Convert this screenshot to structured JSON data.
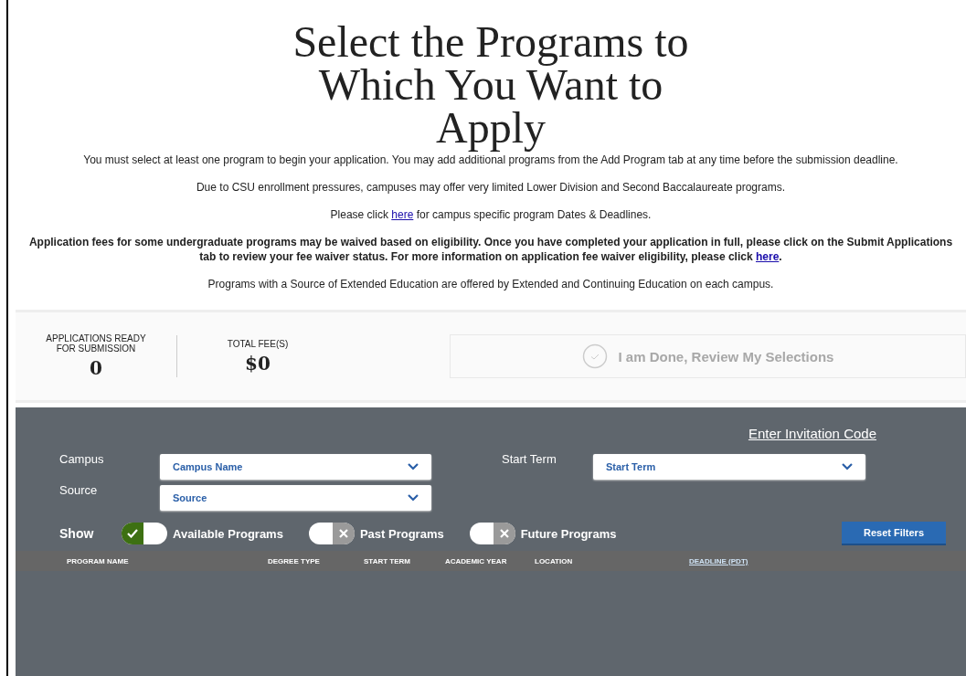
{
  "heading": "Select the Programs to Which You Want to Apply",
  "paragraphs": [
    {
      "bold": false,
      "parts": [
        {
          "kind": "text",
          "text": "You must select at least one program to begin your application. You may add additional programs from the Add Program tab at any time before the submission deadline."
        }
      ]
    },
    {
      "bold": false,
      "parts": [
        {
          "kind": "text",
          "text": "Due to CSU enrollment pressures, campuses may offer very limited Lower Division and Second Baccalaureate programs."
        }
      ]
    },
    {
      "bold": false,
      "parts": [
        {
          "kind": "text",
          "text": "Please click "
        },
        {
          "kind": "link",
          "text": "here"
        },
        {
          "kind": "text",
          "text": " for campus specific program Dates & Deadlines."
        }
      ]
    },
    {
      "bold": true,
      "parts": [
        {
          "kind": "text",
          "text": "Application fees for some undergraduate programs may be waived based on eligibility. Once you have completed your application in full, please click on the Submit Applications tab to review your fee waiver status. For more information on application fee waiver eligibility, please click "
        },
        {
          "kind": "link",
          "text": "here"
        },
        {
          "kind": "text",
          "text": "."
        }
      ]
    },
    {
      "bold": false,
      "parts": [
        {
          "kind": "text",
          "text": "Programs with a Source of Extended Education are offered by Extended and Continuing Education on each campus."
        }
      ]
    }
  ],
  "stats": [
    {
      "label": "APPLICATIONS READY FOR SUBMISSION",
      "value": "0"
    },
    {
      "label": "TOTAL FEE(S)",
      "value": "$0"
    }
  ],
  "done_button": {
    "label": "I am Done, Review My Selections",
    "disabled": true
  },
  "invitation_link": "Enter Invitation Code",
  "filters": [
    {
      "label": "Campus",
      "value": "Campus Name"
    },
    {
      "label": "Source",
      "value": "Source"
    },
    {
      "label": "Start Term",
      "value": "Start Term"
    }
  ],
  "show_label": "Show",
  "toggles": [
    {
      "label": "Available Programs",
      "on": true
    },
    {
      "label": "Past Programs",
      "on": false
    },
    {
      "label": "Future Programs",
      "on": false
    }
  ],
  "reset_button": "Reset Filters",
  "columns": [
    {
      "label": "PROGRAM NAME",
      "sortable": false
    },
    {
      "label": "DEGREE TYPE",
      "sortable": false
    },
    {
      "label": "START TERM",
      "sortable": false
    },
    {
      "label": "ACADEMIC YEAR",
      "sortable": false
    },
    {
      "label": "LOCATION",
      "sortable": false
    },
    {
      "label": "DEADLINE (PDT)",
      "sortable": true
    }
  ]
}
